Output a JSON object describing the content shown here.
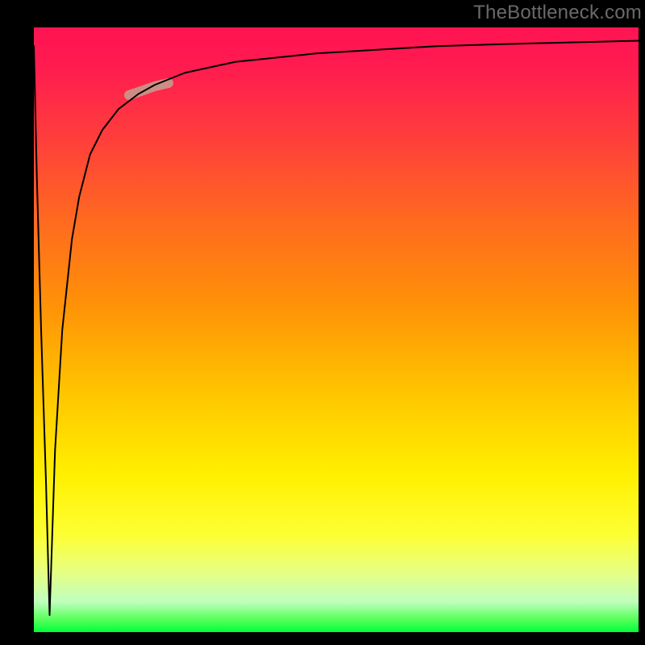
{
  "watermark": "TheBottleneck.com",
  "chart_data": {
    "type": "line",
    "title": "",
    "subtitle": "",
    "xlabel": "",
    "ylabel": "",
    "xlim": [
      0,
      100
    ],
    "ylim": [
      0,
      100
    ],
    "grid": false,
    "legend": null,
    "background_gradient_stops": [
      {
        "pos": 0.0,
        "hex": "#ff1452"
      },
      {
        "pos": 0.06,
        "hex": "#ff1a50"
      },
      {
        "pos": 0.18,
        "hex": "#ff3d3c"
      },
      {
        "pos": 0.32,
        "hex": "#ff6a1f"
      },
      {
        "pos": 0.46,
        "hex": "#ff9207"
      },
      {
        "pos": 0.6,
        "hex": "#ffc400"
      },
      {
        "pos": 0.74,
        "hex": "#fff000"
      },
      {
        "pos": 0.84,
        "hex": "#fdff34"
      },
      {
        "pos": 0.9,
        "hex": "#e7ff82"
      },
      {
        "pos": 0.95,
        "hex": "#bfffbe"
      },
      {
        "pos": 0.98,
        "hex": "#54ff58"
      },
      {
        "pos": 1.0,
        "hex": "#00ff3c"
      }
    ],
    "series": [
      {
        "name": "curve",
        "color": "#000000",
        "stroke_width": 2.0,
        "x": [
          0.0,
          0.5,
          1.2,
          2.0,
          2.6,
          3.5,
          4.7,
          6.3,
          7.5,
          9.3,
          11.3,
          14.0,
          17.3,
          20.0,
          25.0,
          33.3,
          46.7,
          66.7,
          80.0,
          100.0
        ],
        "y": [
          97.0,
          75.0,
          50.0,
          25.0,
          2.8,
          30.0,
          50.0,
          65.0,
          72.0,
          79.0,
          83.0,
          86.5,
          89.0,
          90.5,
          92.5,
          94.3,
          95.7,
          96.9,
          97.3,
          97.8
        ]
      }
    ],
    "highlight_segment": {
      "series": "curve",
      "x_range": [
        15.7,
        22.3
      ],
      "color": "#cc8d83",
      "stroke_width": 12
    }
  }
}
